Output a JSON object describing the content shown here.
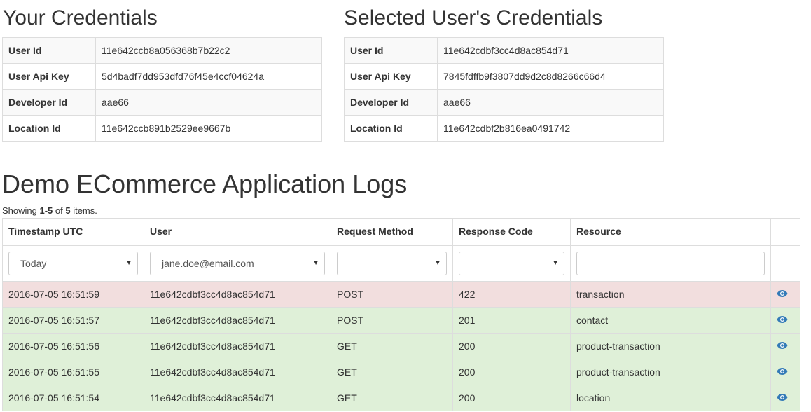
{
  "your_credentials": {
    "title": "Your Credentials",
    "rows": [
      {
        "label": "User Id",
        "value": "11e642ccb8a056368b7b22c2"
      },
      {
        "label": "User Api Key",
        "value": "5d4badf7dd953dfd76f45e4ccf04624a"
      },
      {
        "label": "Developer Id",
        "value": "aae66"
      },
      {
        "label": "Location Id",
        "value": "11e642ccb891b2529ee9667b"
      }
    ]
  },
  "selected_credentials": {
    "title": "Selected User's Credentials",
    "rows": [
      {
        "label": "User Id",
        "value": "11e642cdbf3cc4d8ac854d71"
      },
      {
        "label": "User Api Key",
        "value": "7845fdffb9f3807dd9d2c8d8266c66d4"
      },
      {
        "label": "Developer Id",
        "value": "aae66"
      },
      {
        "label": "Location Id",
        "value": "11e642cdbf2b816ea0491742"
      }
    ]
  },
  "logs": {
    "title": "Demo ECommerce Application Logs",
    "summary": {
      "prefix": "Showing ",
      "range": "1-5",
      "middle": " of ",
      "total": "5",
      "suffix": " items."
    },
    "columns": [
      "Timestamp UTC",
      "User",
      "Request Method",
      "Response Code",
      "Resource",
      ""
    ],
    "filters": {
      "timestamp": "Today",
      "user": "jane.doe@email.com",
      "request_method": "",
      "response_code": "",
      "resource": ""
    },
    "rows": [
      {
        "timestamp": "2016-07-05 16:51:59",
        "user": "11e642cdbf3cc4d8ac854d71",
        "method": "POST",
        "code": "422",
        "resource": "transaction",
        "status": "danger"
      },
      {
        "timestamp": "2016-07-05 16:51:57",
        "user": "11e642cdbf3cc4d8ac854d71",
        "method": "POST",
        "code": "201",
        "resource": "contact",
        "status": "success"
      },
      {
        "timestamp": "2016-07-05 16:51:56",
        "user": "11e642cdbf3cc4d8ac854d71",
        "method": "GET",
        "code": "200",
        "resource": "product-transaction",
        "status": "success"
      },
      {
        "timestamp": "2016-07-05 16:51:55",
        "user": "11e642cdbf3cc4d8ac854d71",
        "method": "GET",
        "code": "200",
        "resource": "product-transaction",
        "status": "success"
      },
      {
        "timestamp": "2016-07-05 16:51:54",
        "user": "11e642cdbf3cc4d8ac854d71",
        "method": "GET",
        "code": "200",
        "resource": "location",
        "status": "success"
      }
    ],
    "view_icon": "eye-icon"
  },
  "colors": {
    "danger_row": "#f2dede",
    "success_row": "#dff0d8",
    "icon_blue": "#337ab7",
    "border": "#dddddd"
  }
}
